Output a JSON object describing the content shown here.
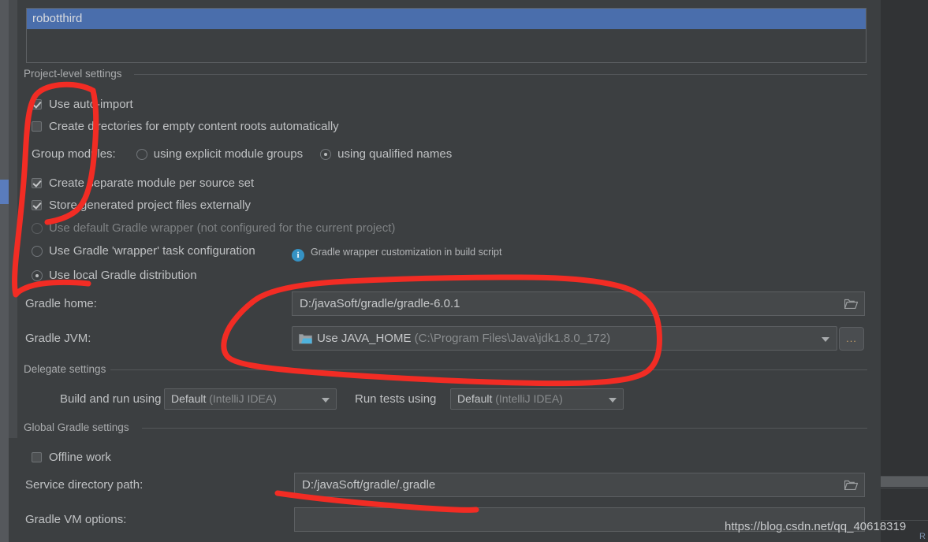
{
  "window": {
    "watermark": "https://blog.csdn.net/qq_40618319",
    "right_panel_letter": "R"
  },
  "project_list": {
    "items": [
      {
        "label": "robotthird",
        "selected": true
      }
    ]
  },
  "project_level_settings": {
    "group_label": "Project-level settings",
    "use_auto_import": {
      "label": "Use auto-import",
      "checked": true
    },
    "create_empty_dirs": {
      "label": "Create directories for empty content roots automatically",
      "checked": false
    },
    "group_modules": {
      "label": "Group modules:",
      "options": [
        {
          "label": "using explicit module groups",
          "selected": false
        },
        {
          "label": "using qualified names",
          "selected": true
        }
      ]
    },
    "create_separate_module": {
      "label": "Create separate module per source set",
      "checked": true
    },
    "store_generated_externally": {
      "label": "Store generated project files externally",
      "checked": true
    },
    "distribution_options": [
      {
        "label": "Use default Gradle wrapper (not configured for the current project)",
        "selected": false,
        "disabled": true
      },
      {
        "label": "Use Gradle 'wrapper' task configuration",
        "selected": false,
        "disabled": false
      },
      {
        "label": "Use local Gradle distribution",
        "selected": true,
        "disabled": false
      }
    ],
    "wrapper_hint": {
      "icon": "info-icon",
      "text": "Gradle wrapper customization in build script"
    },
    "gradle_home": {
      "label": "Gradle home:",
      "value": "D:/javaSoft/gradle/gradle-6.0.1",
      "browse_icon": "folder-icon"
    },
    "gradle_jvm": {
      "label": "Gradle JVM:",
      "value_main": "Use JAVA_HOME",
      "value_muted": "(C:\\Program Files\\Java\\jdk1.8.0_172)",
      "icon": "java-folder-icon",
      "more_button": "..."
    }
  },
  "delegate_settings": {
    "group_label": "Delegate settings",
    "build_and_run": {
      "label": "Build and run using",
      "value_main": "Default",
      "value_muted": "(IntelliJ IDEA)"
    },
    "run_tests": {
      "label": "Run tests using",
      "value_main": "Default",
      "value_muted": "(IntelliJ IDEA)"
    }
  },
  "global_gradle_settings": {
    "group_label": "Global Gradle settings",
    "offline_work": {
      "label": "Offline work",
      "checked": false
    },
    "service_directory_path": {
      "label": "Service directory path:",
      "value": "D:/javaSoft/gradle/.gradle",
      "browse_icon": "folder-icon"
    },
    "gradle_vm_options": {
      "label": "Gradle VM options:",
      "value": ""
    }
  },
  "colors": {
    "background": "#3c3f41",
    "selection_blue": "#4a6eac",
    "field_background": "#45484a",
    "annotation_red": "#f22c24",
    "info_blue": "#3592c4"
  }
}
